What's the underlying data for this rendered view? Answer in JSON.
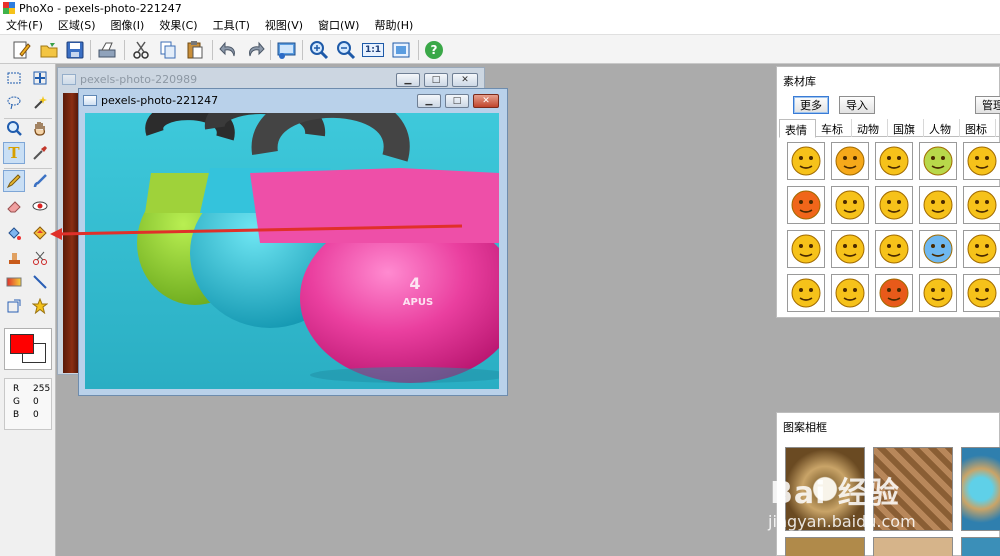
{
  "app": {
    "title": "PhoXo - pexels-photo-221247"
  },
  "menu": [
    "文件(F)",
    "区域(S)",
    "图像(I)",
    "效果(C)",
    "工具(T)",
    "视图(V)",
    "窗口(W)",
    "帮助(H)"
  ],
  "toolbar": {
    "icons": [
      "new-file-icon",
      "open-folder-icon",
      "save-icon",
      "scan-icon",
      "cut-icon",
      "copy-icon",
      "paste-icon",
      "undo-icon",
      "redo-icon",
      "screen-capture-icon",
      "zoom-in-icon",
      "zoom-out-icon",
      "actual-size-icon",
      "fit-window-icon",
      "help-icon"
    ],
    "actual_size_label": "1:1",
    "help_label": "?"
  },
  "tools": [
    "rect-select-icon",
    "move-selection-icon",
    "lasso-icon",
    "magic-wand-icon",
    "zoom-icon",
    "hand-icon",
    "text-icon",
    "eyedropper-icon",
    "pencil-icon",
    "brush-icon",
    "eraser-icon",
    "red-eye-icon",
    "fill-bucket-icon",
    "color-replace-icon",
    "clone-stamp-icon",
    "scissors-icon",
    "gradient-icon",
    "line-icon",
    "transform-icon",
    "shape-star-icon"
  ],
  "colors": {
    "foreground": "#ff0000",
    "background": "#ffffff",
    "accent": "#e0302a"
  },
  "rgb": {
    "r_label": "R",
    "r": "255",
    "g_label": "G",
    "g": "0",
    "b_label": "B",
    "b": "0"
  },
  "windows": {
    "back_title": "pexels-photo-220989",
    "front_title": "pexels-photo-221247",
    "photo_brand": "APUS",
    "photo_weight": "4"
  },
  "sticker_panel": {
    "title": "素材库",
    "more_button": "更多",
    "import_button": "导入",
    "manage_button": "管理",
    "tabs": [
      "表情",
      "车标",
      "动物",
      "国旗",
      "人物",
      "图标"
    ]
  },
  "frame_panel": {
    "title": "图案相框"
  },
  "watermark": {
    "main": "Bai 经验",
    "sub": "jingyan.baidu.com"
  }
}
